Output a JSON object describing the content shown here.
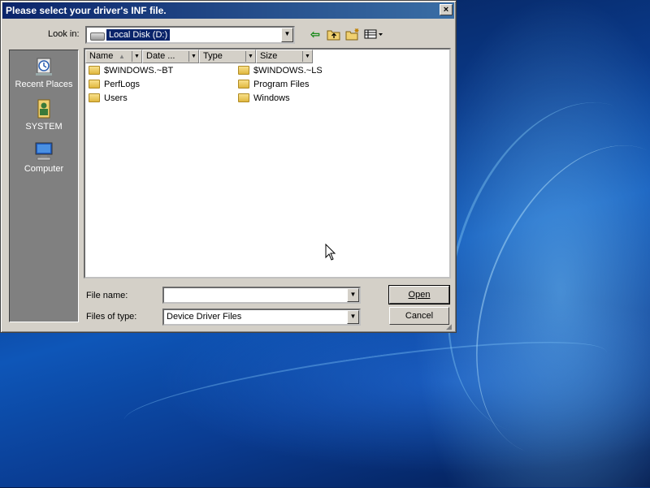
{
  "dialog": {
    "title": "Please select your driver's INF file.",
    "close_label": "×",
    "look_in_label": "Look in:",
    "look_in_value": "Local Disk (D:)",
    "toolbar_icons": [
      "back-icon",
      "up-one-level-icon",
      "new-folder-icon",
      "views-icon"
    ],
    "places": [
      {
        "label": "Recent Places",
        "icon": "recent-places-icon"
      },
      {
        "label": "SYSTEM",
        "icon": "user-folder-icon"
      },
      {
        "label": "Computer",
        "icon": "computer-icon"
      }
    ],
    "columns": [
      "Name",
      "Date ...",
      "Type",
      "Size"
    ],
    "files": [
      {
        "name": "$WINDOWS.~BT"
      },
      {
        "name": "$WINDOWS.~LS"
      },
      {
        "name": "PerfLogs"
      },
      {
        "name": "Program Files"
      },
      {
        "name": "Users"
      },
      {
        "name": "Windows"
      }
    ],
    "file_name_label": "File name:",
    "file_name_value": "",
    "file_type_label": "Files of type:",
    "file_type_value": "Device Driver Files",
    "open_label": "Open",
    "cancel_label": "Cancel"
  },
  "colors": {
    "title_bar": "#0a246a",
    "dialog_bg": "#d4d0c8",
    "places_bg": "#808080",
    "selection": "#0a246a"
  }
}
